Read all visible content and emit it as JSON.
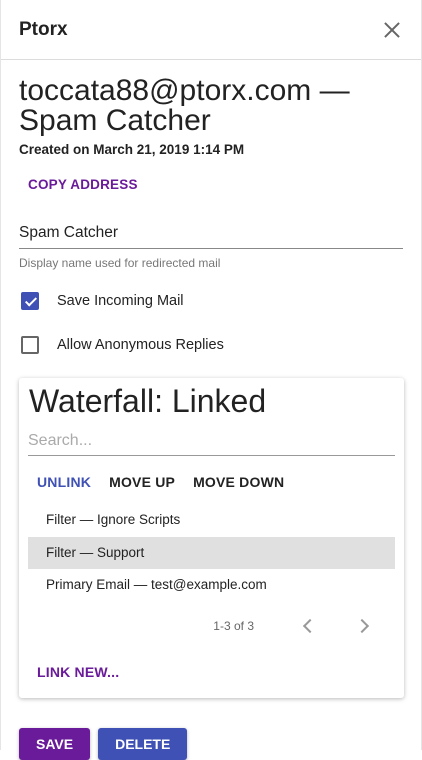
{
  "app_bar": {
    "title": "Ptorx"
  },
  "alias": {
    "address_line": "toccata88@ptorx.com —",
    "name_line": "Spam Catcher",
    "created": "Created on March 21, 2019 1:14 PM",
    "copy_label": "Copy Address"
  },
  "display_name_field": {
    "value": "Spam Catcher",
    "hint": "Display name used for redirected mail"
  },
  "options": [
    {
      "label": "Save Incoming Mail",
      "checked": true
    },
    {
      "label": "Allow Anonymous Replies",
      "checked": false
    }
  ],
  "waterfall": {
    "title": "Waterfall: Linked",
    "search_placeholder": "Search...",
    "actions": {
      "unlink": "Unlink",
      "move_up": "Move Up",
      "move_down": "Move Down"
    },
    "items": [
      {
        "label": "Filter — Ignore Scripts",
        "selected": false
      },
      {
        "label": "Filter — Support",
        "selected": true
      },
      {
        "label": "Primary Email — test@example.com",
        "selected": false
      }
    ],
    "pagination": "1-3 of 3",
    "link_new": "Link New..."
  },
  "buttons": {
    "save": "Save",
    "delete": "Delete"
  },
  "colors": {
    "primary": "#6a1b9a",
    "secondary": "#3f51b5",
    "selected_row": "#e0e0e0"
  }
}
